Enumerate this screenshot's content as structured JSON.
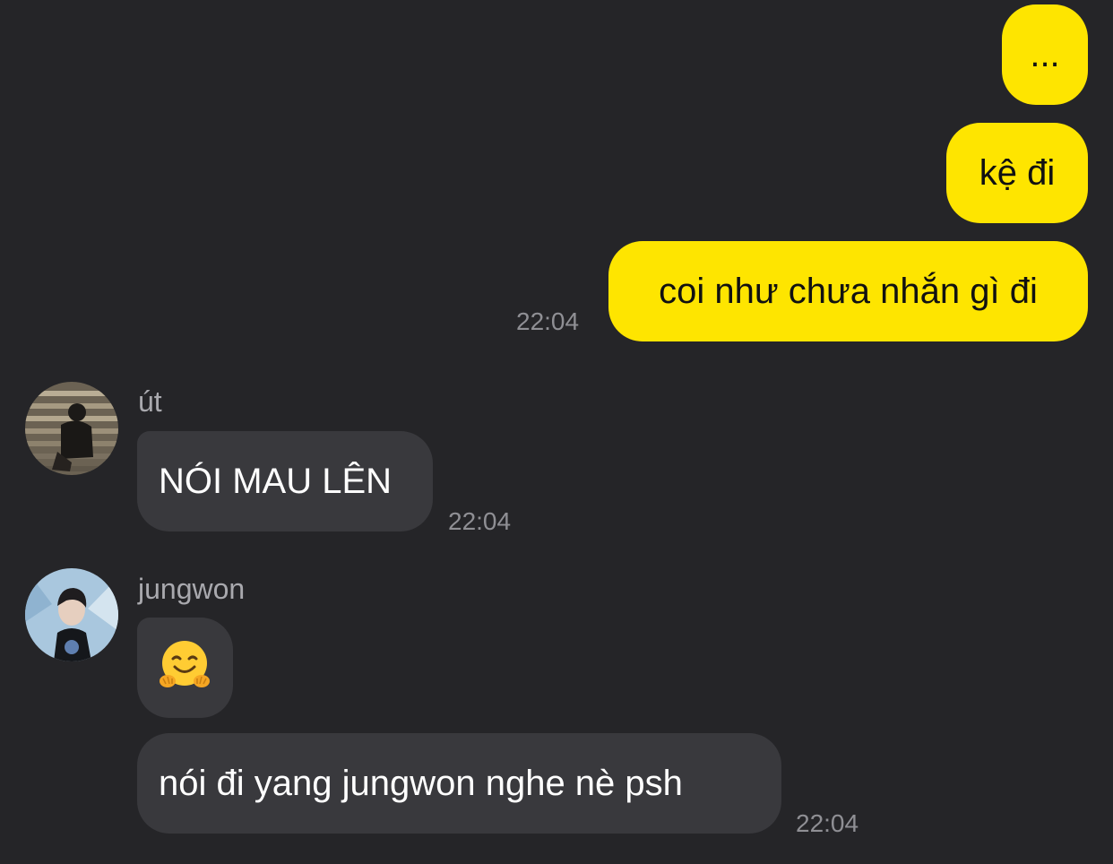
{
  "outgoing": [
    {
      "text": "..."
    },
    {
      "text": "kệ đi"
    },
    {
      "text": "coi như chưa nhắn gì đi",
      "time": "22:04"
    }
  ],
  "groups": [
    {
      "sender": "út",
      "avatar_icon": "person-crouching-on-stairs-photo",
      "messages": [
        {
          "text": "NÓI MAU LÊN",
          "time": "22:04"
        }
      ]
    },
    {
      "sender": "jungwon",
      "avatar_icon": "person-portrait-photo",
      "messages": [
        {
          "emoji": "hugging-face-emoji"
        },
        {
          "text": "nói đi yang jungwon nghe nè psh",
          "time": "22:04"
        }
      ]
    }
  ],
  "colors": {
    "background": "#252528",
    "outgoing_bubble": "#FEE500",
    "incoming_bubble": "#39393d",
    "timestamp": "#8f8f94"
  }
}
